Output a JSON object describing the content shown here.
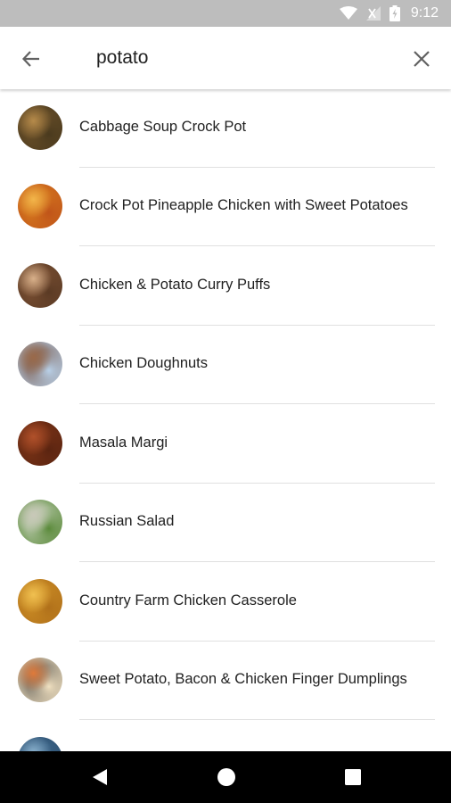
{
  "status_bar": {
    "time": "9:12",
    "icons": [
      "wifi-icon",
      "signal-icon",
      "battery-icon"
    ]
  },
  "search": {
    "query": "potato",
    "back_icon": "arrow-back-icon",
    "clear_icon": "close-icon"
  },
  "results": [
    {
      "title": "Cabbage Soup Crock Pot",
      "thumb_colors": [
        "#7a5a2e",
        "#b58a4a",
        "#4a3a1e"
      ]
    },
    {
      "title": "Crock Pot Pineapple Chicken with Sweet Potatoes",
      "thumb_colors": [
        "#e08a1e",
        "#f2b54a",
        "#c0541a"
      ]
    },
    {
      "title": "Chicken & Potato Curry Puffs",
      "thumb_colors": [
        "#8a5a3a",
        "#d8b08a",
        "#5a3a24"
      ]
    },
    {
      "title": "Chicken Doughnuts",
      "thumb_colors": [
        "#6a3a22",
        "#9a6a4a",
        "#b8d0e8"
      ]
    },
    {
      "title": "Masala Margi",
      "thumb_colors": [
        "#8a3a1a",
        "#b0502a",
        "#5a2410"
      ]
    },
    {
      "title": "Russian Salad",
      "thumb_colors": [
        "#e6e6e0",
        "#c8c8b8",
        "#5a8a3a"
      ]
    },
    {
      "title": "Country Farm Chicken Casserole",
      "thumb_colors": [
        "#d89a2a",
        "#f0c050",
        "#b0701a"
      ]
    },
    {
      "title": "Sweet Potato, Bacon & Chicken Finger Dumplings",
      "thumb_colors": [
        "#3a3a3a",
        "#e07a3a",
        "#f0e0c0"
      ]
    },
    {
      "title": "",
      "thumb_colors": [
        "#4a7aa0",
        "#8ab0cc",
        "#2a4a6a"
      ]
    }
  ],
  "nav_bar": {
    "buttons": [
      "back-triangle-icon",
      "home-circle-icon",
      "recents-square-icon"
    ]
  }
}
